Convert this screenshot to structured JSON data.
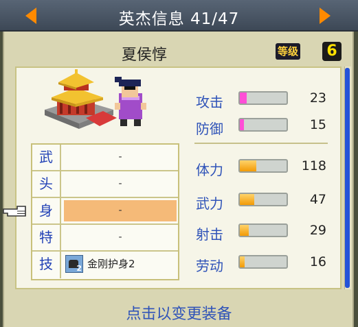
{
  "header": {
    "title": "英杰信息 41/47",
    "prev_icon": "left-arrow-icon",
    "next_icon": "right-arrow-icon",
    "arrow_color": "#ff8a00"
  },
  "hero": {
    "name": "夏侯惇",
    "level_label": "等级",
    "level_value": "6"
  },
  "equipment": [
    {
      "slot": "武",
      "value": "-"
    },
    {
      "slot": "头",
      "value": "-"
    },
    {
      "slot": "身",
      "value": "-",
      "selected": true
    },
    {
      "slot": "特",
      "value": "-"
    },
    {
      "slot": "技",
      "skill_name": "金刚护身2",
      "skill_icon_number": "2",
      "skill_icon": "armor-skill-icon"
    }
  ],
  "stats": [
    {
      "label": "攻击",
      "value": "23",
      "fraction": 0.14,
      "color": "#ff4ed6"
    },
    {
      "label": "防御",
      "value": "15",
      "fraction": 0.09,
      "color": "#ff4ed6"
    },
    {
      "label": "体力",
      "value": "118",
      "fraction": 0.36,
      "color": "#f29a06"
    },
    {
      "label": "武力",
      "value": "47",
      "fraction": 0.31,
      "color": "#f29a06"
    },
    {
      "label": "射击",
      "value": "29",
      "fraction": 0.19,
      "color": "#f29a06"
    },
    {
      "label": "劳动",
      "value": "16",
      "fraction": 0.11,
      "color": "#f29a06"
    }
  ],
  "hint": "点击以变更装备",
  "colors": {
    "accent_blue": "#2f53b8",
    "selected_row": "#f5ba78",
    "scrollbar": "#2453d8"
  }
}
